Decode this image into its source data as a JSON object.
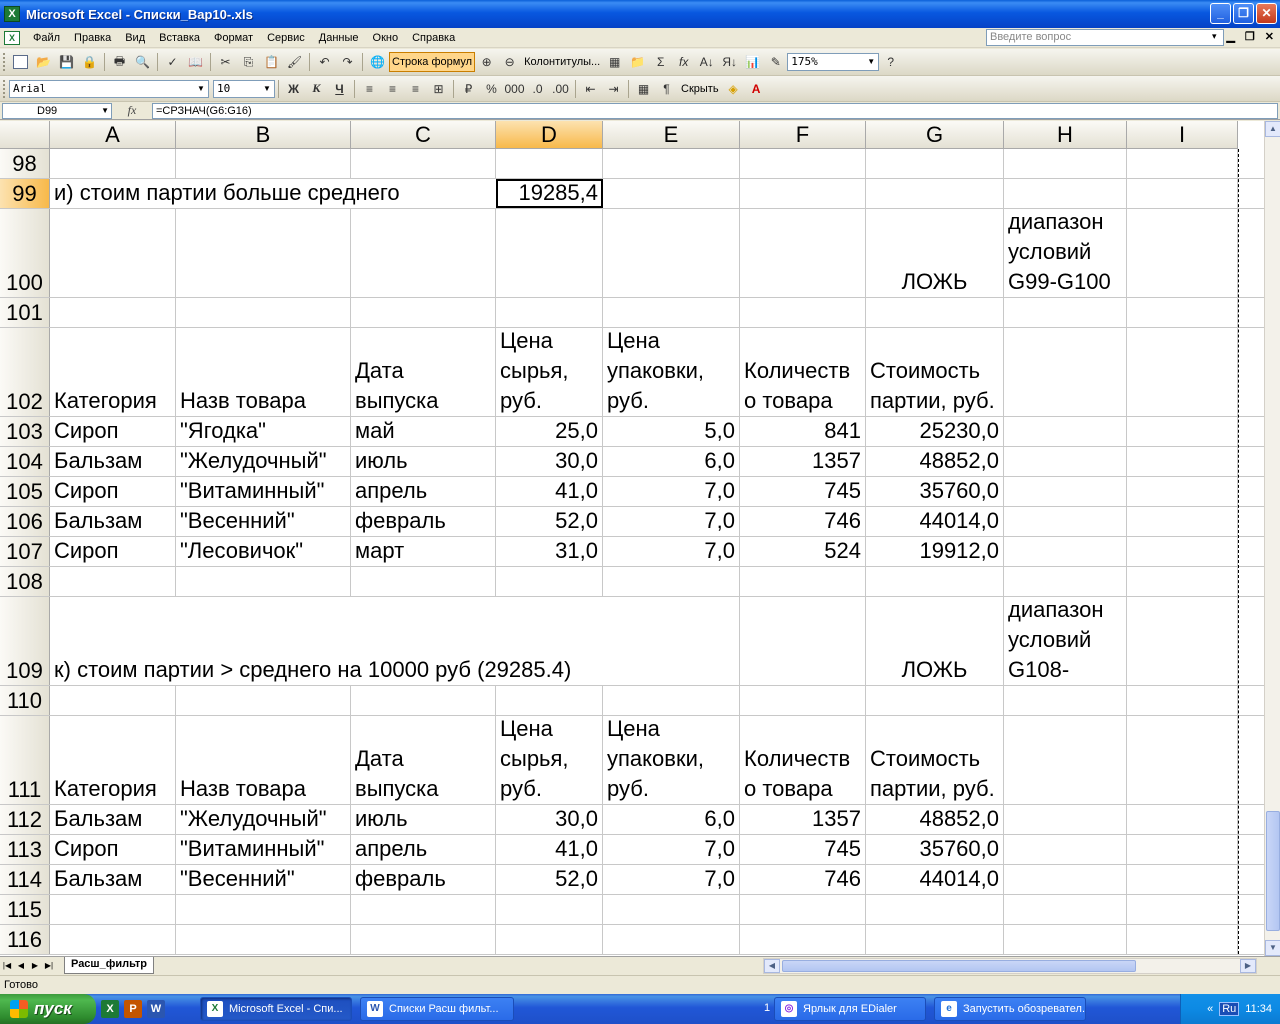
{
  "window": {
    "title": "Microsoft Excel - Списки_Вар10-.xls",
    "minimize": "_",
    "restore": "❐",
    "close": "✕"
  },
  "menu": {
    "items": [
      "Файл",
      "Правка",
      "Вид",
      "Вставка",
      "Формат",
      "Сервис",
      "Данные",
      "Окно",
      "Справка"
    ],
    "help_placeholder": "Введите вопрос"
  },
  "toolbar1": {
    "formula_bar_button": "Строка формул",
    "headers_button": "Колонтитулы...",
    "zoom": "175%"
  },
  "toolbar2": {
    "font": "Arial",
    "size": "10",
    "bold": "Ж",
    "italic": "К",
    "underline": "Ч",
    "hide_label": "Скрыть"
  },
  "formula_bar": {
    "name_box": "D99",
    "fx": "fx",
    "formula": "=СРЗНАЧ(G6:G16)"
  },
  "grid": {
    "columns": [
      "A",
      "B",
      "C",
      "D",
      "E",
      "F",
      "G",
      "H",
      "I"
    ],
    "active_column": "D",
    "active_row": "99",
    "rows": [
      {
        "n": "98",
        "cells": {}
      },
      {
        "n": "99",
        "cells": {
          "A": "и) стоим  партии больше среднего",
          "D": "19285,4"
        }
      },
      {
        "n": "100",
        "cells": {
          "G": "ЛОЖЬ",
          "H": "диапазон условий G99-G100"
        }
      },
      {
        "n": "101",
        "cells": {}
      },
      {
        "n": "102",
        "cells": {
          "A": "Категория",
          "B": "Назв товара",
          "C": "Дата выпуска",
          "D": "Цена сырья, руб.",
          "E": "Цена упаковки, руб.",
          "F": "Количеств о товара",
          "G": "Стоимость партии, руб."
        }
      },
      {
        "n": "103",
        "cells": {
          "A": "Сироп",
          "B": "\"Ягодка\"",
          "C": "май",
          "D": "25,0",
          "E": "5,0",
          "F": "841",
          "G": "25230,0"
        }
      },
      {
        "n": "104",
        "cells": {
          "A": "Бальзам",
          "B": "\"Желудочный\"",
          "C": "июль",
          "D": "30,0",
          "E": "6,0",
          "F": "1357",
          "G": "48852,0"
        }
      },
      {
        "n": "105",
        "cells": {
          "A": "Сироп",
          "B": "\"Витаминный\"",
          "C": "апрель",
          "D": "41,0",
          "E": "7,0",
          "F": "745",
          "G": "35760,0"
        }
      },
      {
        "n": "106",
        "cells": {
          "A": "Бальзам",
          "B": "\"Весенний\"",
          "C": "февраль",
          "D": "52,0",
          "E": "7,0",
          "F": "746",
          "G": "44014,0"
        }
      },
      {
        "n": "107",
        "cells": {
          "A": "Сироп",
          "B": "\"Лесовичок\"",
          "C": "март",
          "D": "31,0",
          "E": "7,0",
          "F": "524",
          "G": "19912,0"
        }
      },
      {
        "n": "108",
        "cells": {}
      },
      {
        "n": "109",
        "cells": {
          "A": "к) стоим партии > среднего на 10000 руб (29285.4)",
          "G": "ЛОЖЬ",
          "H": "диапазон условий G108-"
        }
      },
      {
        "n": "110",
        "cells": {}
      },
      {
        "n": "111",
        "cells": {
          "A": "Категория",
          "B": "Назв товара",
          "C": "Дата выпуска",
          "D": "Цена сырья, руб.",
          "E": "Цена упаковки, руб.",
          "F": "Количеств о товара",
          "G": "Стоимость партии, руб."
        }
      },
      {
        "n": "112",
        "cells": {
          "A": "Бальзам",
          "B": "\"Желудочный\"",
          "C": "июль",
          "D": "30,0",
          "E": "6,0",
          "F": "1357",
          "G": "48852,0"
        }
      },
      {
        "n": "113",
        "cells": {
          "A": "Сироп",
          "B": "\"Витаминный\"",
          "C": "апрель",
          "D": "41,0",
          "E": "7,0",
          "F": "745",
          "G": "35760,0"
        }
      },
      {
        "n": "114",
        "cells": {
          "A": "Бальзам",
          "B": "\"Весенний\"",
          "C": "февраль",
          "D": "52,0",
          "E": "7,0",
          "F": "746",
          "G": "44014,0"
        }
      },
      {
        "n": "115",
        "cells": {}
      },
      {
        "n": "116",
        "cells": {}
      }
    ]
  },
  "sheet_tab": "Расш_фильтр",
  "status": "Готово",
  "taskbar": {
    "start": "пуск",
    "tasks": [
      "Microsoft Excel - Спи...",
      "Списки Расш фильт...",
      "Ярлык для EDialer",
      "Запустить обозревател..."
    ],
    "task_count": "1",
    "lang": "Ru",
    "clock": "11:34"
  }
}
